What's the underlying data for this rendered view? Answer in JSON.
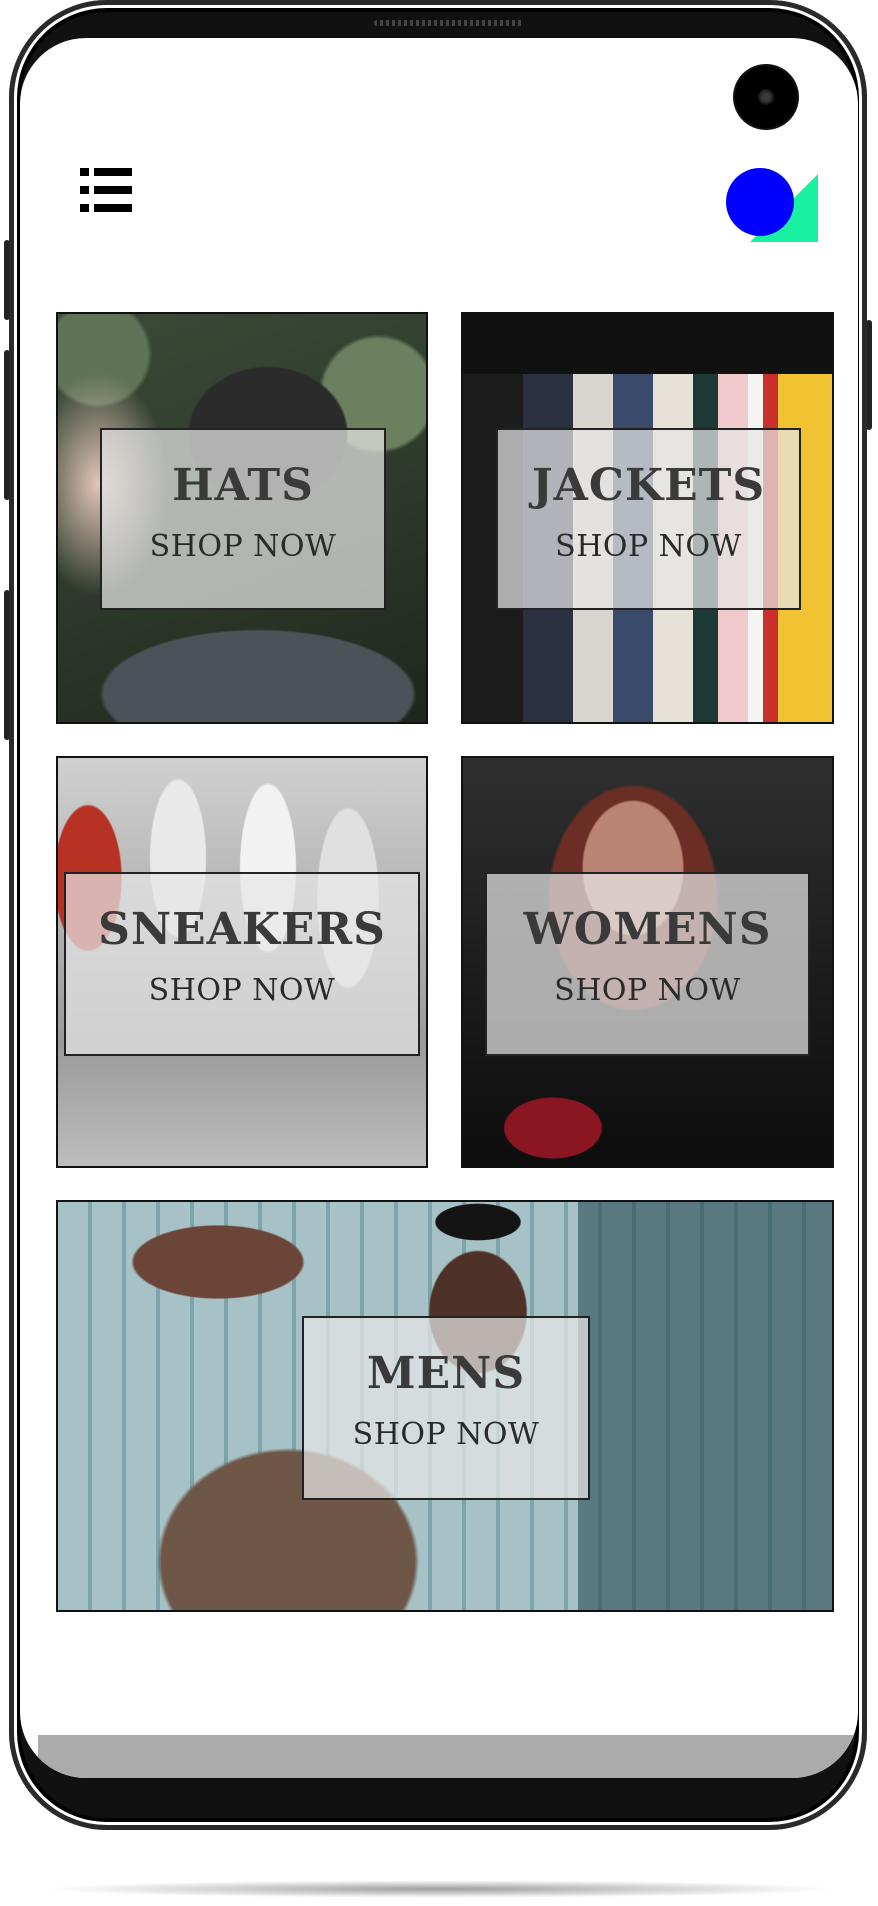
{
  "header": {
    "menu_icon": "list-icon",
    "logo_icon": "brand-logo-icon"
  },
  "colors": {
    "logo_circle": "#0000ff",
    "logo_triangle": "#19f0a0",
    "label_border": "#222222",
    "tile_border": "#111111"
  },
  "categories": [
    {
      "title": "HATS",
      "cta": "SHOP NOW"
    },
    {
      "title": "JACKETS",
      "cta": "SHOP NOW"
    },
    {
      "title": "SNEAKERS",
      "cta": "SHOP NOW"
    },
    {
      "title": "WOMENS",
      "cta": "SHOP NOW"
    },
    {
      "title": "MENS",
      "cta": "SHOP NOW"
    }
  ]
}
